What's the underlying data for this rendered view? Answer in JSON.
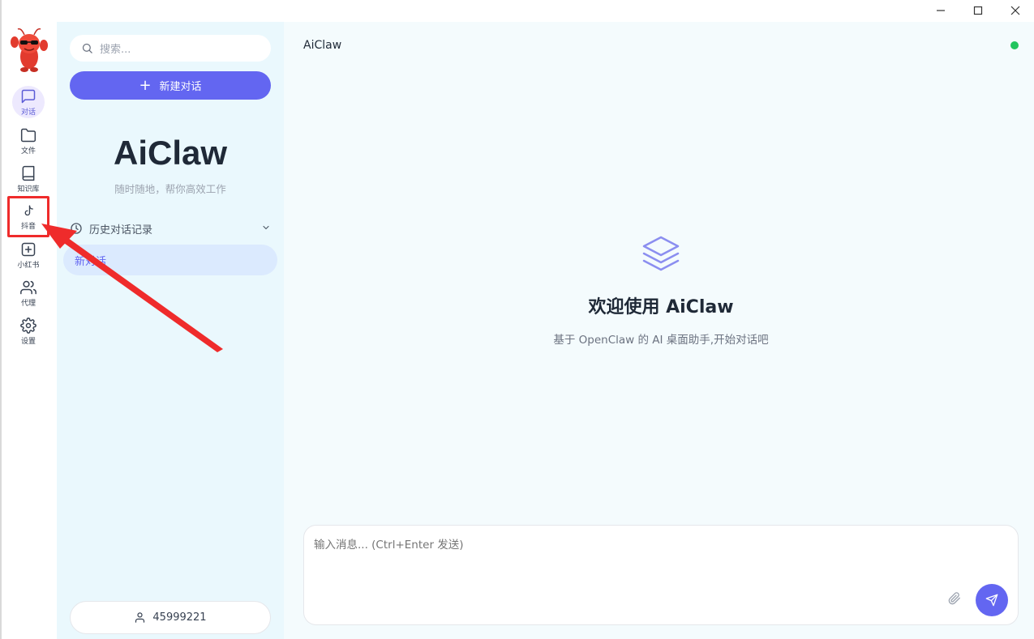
{
  "window": {
    "controls": [
      "minimize",
      "maximize",
      "close"
    ]
  },
  "rail": {
    "items": [
      {
        "label": "对话",
        "icon": "chat-icon",
        "active": true
      },
      {
        "label": "文件",
        "icon": "folder-icon"
      },
      {
        "label": "知识库",
        "icon": "book-icon"
      },
      {
        "label": "抖音",
        "icon": "tiktok-icon"
      },
      {
        "label": "小红书",
        "icon": "plus-square-icon"
      },
      {
        "label": "代理",
        "icon": "users-icon"
      },
      {
        "label": "设置",
        "icon": "gear-icon"
      }
    ]
  },
  "sidebar": {
    "search_placeholder": "搜索...",
    "new_chat_label": "新建对话",
    "brand": "AiClaw",
    "tagline": "随时随地，帮你高效工作",
    "history_title": "历史对话记录",
    "history_items": [
      "新对话"
    ],
    "user_id": "45999221"
  },
  "main": {
    "title": "AiClaw",
    "welcome_title": "欢迎使用 AiClaw",
    "welcome_sub": "基于 OpenClaw 的 AI 桌面助手,开始对话吧",
    "input_placeholder": "输入消息... (Ctrl+Enter 发送)"
  },
  "colors": {
    "accent": "#6366f1",
    "sidebar_bg": "#eaf8fd",
    "main_bg": "#f4fbfd",
    "status_online": "#22c55e",
    "annotation_red": "#ef2b2b"
  }
}
